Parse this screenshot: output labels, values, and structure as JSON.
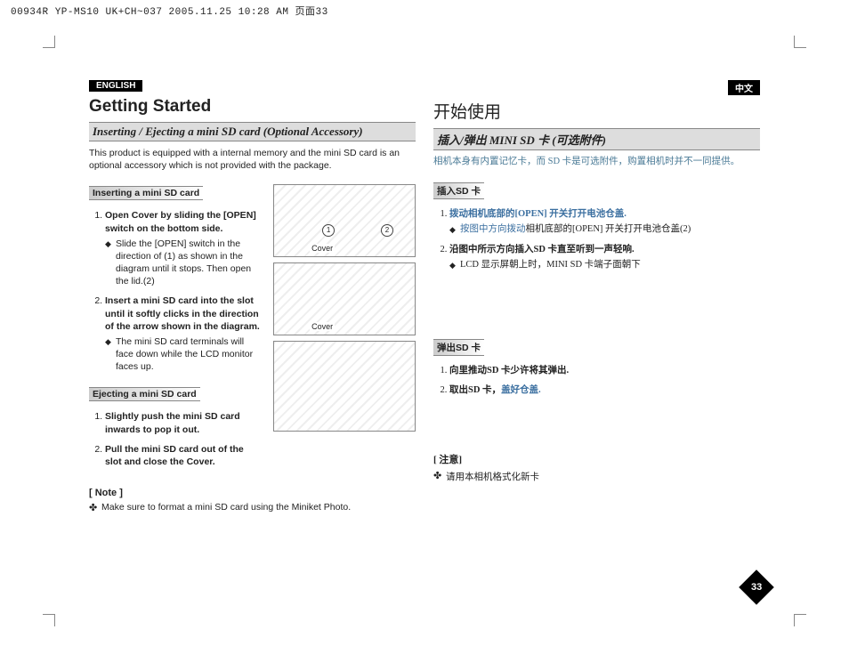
{
  "meta_header": "00934R YP-MS10 UK+CH~037  2005.11.25 10:28 AM  页面33",
  "page_number": "33",
  "left": {
    "lang_tab": "ENGLISH",
    "title": "Getting Started",
    "section_bar": "Inserting / Ejecting a mini SD card (Optional Accessory)",
    "intro": "This product is equipped with a internal memory and the mini SD card is an optional accessory which is not provided with the package.",
    "insert_head": "Inserting a mini SD card",
    "insert_steps": [
      {
        "title": "Open Cover by sliding the [OPEN] switch on the bottom side.",
        "bullets": [
          "Slide the [OPEN] switch in the direction of (1) as shown in the diagram until it stops. Then open the lid.(2)"
        ]
      },
      {
        "title": "Insert a mini SD card into the slot until it softly clicks in the direction of the arrow shown in the diagram.",
        "bullets": [
          "The mini SD card terminals will face down while the LCD monitor faces up."
        ]
      }
    ],
    "eject_head": "Ejecting a mini SD card",
    "eject_steps": [
      {
        "title": "Slightly push the mini SD card inwards to pop it out."
      },
      {
        "title": "Pull the mini SD card out of the slot and close the Cover."
      }
    ],
    "note_title": "[ Note ]",
    "note_items": [
      "Make sure to format a mini SD card using the Miniket Photo."
    ],
    "diagram_label_cover": "Cover",
    "diagram_mark_1": "1",
    "diagram_mark_2": "2"
  },
  "right": {
    "lang_tab": "中文",
    "title": "开始使用",
    "section_bar": "插入/弹出 MINI SD 卡 (可选附件)",
    "intro": "相机本身有内置记忆卡，而 SD 卡是可选附件，购置相机时并不一同提供。",
    "insert_head": "插入SD 卡",
    "insert_steps": [
      {
        "title_pre": "拨动相机底部的",
        "title_key": "[OPEN]",
        "title_post": " 开关打开电池仓盖.",
        "bullets_pre": "按图中方向拨动",
        "bullets_post": "相机底部的[OPEN] 开关打开电池仓盖(2)"
      },
      {
        "title": "沿图中所示方向插入SD 卡直至听到一声轻响.",
        "bullets": [
          "LCD 显示屏朝上时，MINI SD 卡端子面朝下"
        ]
      }
    ],
    "eject_head": "弹出SD 卡",
    "eject_steps": [
      {
        "title": "向里推动SD 卡少许将其弹出."
      },
      {
        "title_pre": "取出SD 卡，",
        "title_blue": "盖好仓盖."
      }
    ],
    "note_title": "[ 注意]",
    "note_items": [
      "请用本相机格式化新卡"
    ]
  }
}
